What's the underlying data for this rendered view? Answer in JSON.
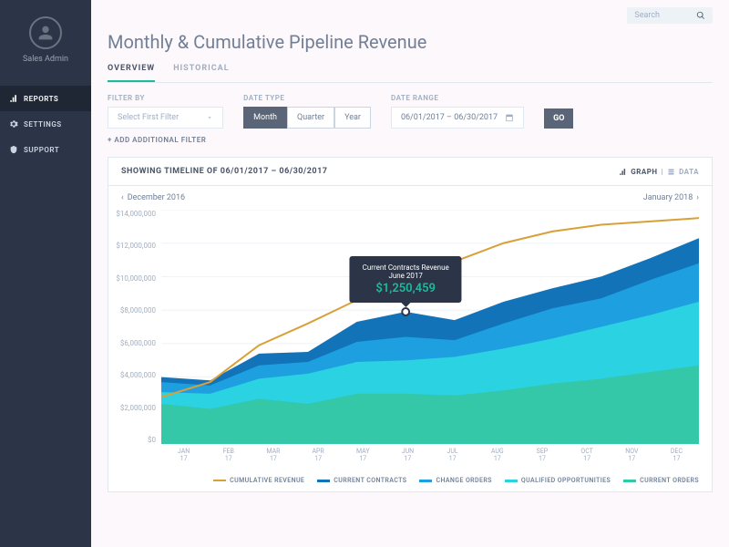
{
  "user": {
    "label": "Sales Admin"
  },
  "sidebar": {
    "items": [
      {
        "label": "REPORTS"
      },
      {
        "label": "SETTINGS"
      },
      {
        "label": "SUPPORT"
      }
    ]
  },
  "search": {
    "placeholder": "Search"
  },
  "page_title": "Monthly & Cumulative Pipeline Revenue",
  "tabs": [
    {
      "label": "OVERVIEW"
    },
    {
      "label": "HISTORICAL"
    }
  ],
  "filters": {
    "filter_by_label": "FILTER BY",
    "filter_by_value": "Select First Filter",
    "date_type_label": "DATE TYPE",
    "date_types": [
      "Month",
      "Quarter",
      "Year"
    ],
    "date_range_label": "DATE RANGE",
    "date_range_value": "06/01/2017 – 06/30/2017",
    "go_label": "GO",
    "add_filter_label": "+ ADD ADDITIONAL FILTER"
  },
  "chart_header": {
    "title": "SHOWING TIMELINE OF 06/01/2017 – 06/30/2017",
    "graph_label": "GRAPH",
    "data_label": "DATA"
  },
  "nav": {
    "prev": "December 2016",
    "next": "January 2018"
  },
  "tooltip": {
    "title": "Current Contracts Revenue",
    "sub": "June 2017",
    "value": "$1,250,459"
  },
  "legend": {
    "cumulative": "CUMULATIVE REVENUE",
    "contracts": "CURRENT CONTRACTS",
    "change": "CHANGE ORDERS",
    "qualified": "QUALIFIED OPPORTUNITIES",
    "orders": "CURRENT ORDERS"
  },
  "chart_data": {
    "type": "area",
    "categories": [
      "JAN 17",
      "FEB 17",
      "MAR 17",
      "APR 17",
      "MAY 17",
      "JUN 17",
      "JUL 17",
      "AUG 17",
      "SEP 17",
      "OCT 17",
      "NOV 17",
      "DEC 17"
    ],
    "ylabel": "",
    "ylim": [
      0,
      14000000
    ],
    "y_ticks": [
      "$14,000,000",
      "$12,000,000",
      "$10,000,000",
      "$8,000,000",
      "$6,000,000",
      "$4,000,000",
      "$2,000,000",
      "$0"
    ],
    "series": [
      {
        "name": "Current Orders",
        "color": "#34c8a8",
        "stack_top": [
          2400000,
          2100000,
          2700000,
          2400000,
          3000000,
          3000000,
          2900000,
          3200000,
          3600000,
          3900000,
          4300000,
          4700000
        ]
      },
      {
        "name": "Qualified Opportunities",
        "color": "#2ad2e2",
        "stack_top": [
          3100000,
          3000000,
          3900000,
          4200000,
          4900000,
          5000000,
          5200000,
          5700000,
          6300000,
          7000000,
          7700000,
          8500000
        ]
      },
      {
        "name": "Change Orders",
        "color": "#1e9fe0",
        "stack_top": [
          3700000,
          3500000,
          4700000,
          4900000,
          6100000,
          6400000,
          6200000,
          7200000,
          8100000,
          8700000,
          9800000,
          10800000
        ]
      },
      {
        "name": "Current Contracts",
        "color": "#1273b8",
        "stack_top": [
          4000000,
          3800000,
          5400000,
          5500000,
          7300000,
          7900000,
          7400000,
          8500000,
          9300000,
          10000000,
          11100000,
          12300000
        ]
      }
    ],
    "line_series": {
      "name": "Cumulative Revenue",
      "color": "#d9a038",
      "values": [
        2800000,
        3700000,
        5900000,
        7200000,
        8600000,
        9700000,
        10900000,
        12000000,
        12700000,
        13100000,
        13300000,
        13500000
      ]
    }
  }
}
